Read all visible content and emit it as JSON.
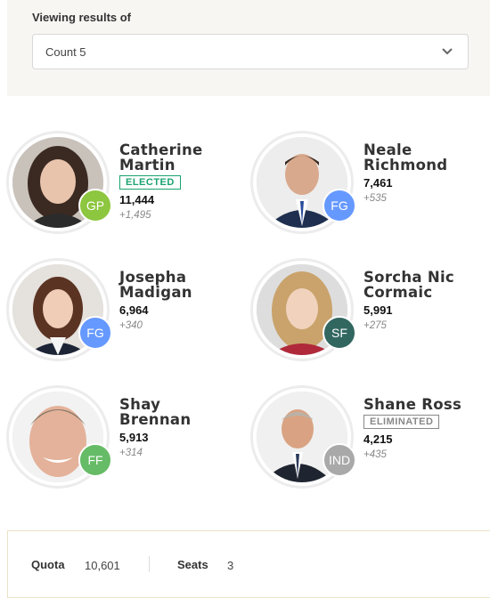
{
  "filter": {
    "label": "Viewing results of",
    "selected": "Count 5"
  },
  "candidates": [
    {
      "first": "Catherine",
      "last": "Martin",
      "party": "GP",
      "party_color": "#8dc63f",
      "status": "ELECTED",
      "status_color": "#1aa36f",
      "votes": "11,444",
      "change": "+1,495"
    },
    {
      "first": "Neale",
      "last": "Richmond",
      "party": "FG",
      "party_color": "#6699ff",
      "status": "",
      "status_color": "",
      "votes": "7,461",
      "change": "+535"
    },
    {
      "first": "Josepha",
      "last": "Madigan",
      "party": "FG",
      "party_color": "#6699ff",
      "status": "",
      "status_color": "",
      "votes": "6,964",
      "change": "+340"
    },
    {
      "first": "Sorcha Nic",
      "last": "Cormaic",
      "party": "SF",
      "party_color": "#326760",
      "status": "",
      "status_color": "",
      "votes": "5,991",
      "change": "+275"
    },
    {
      "first": "Shay",
      "last": "Brennan",
      "party": "FF",
      "party_color": "#66bb66",
      "status": "",
      "status_color": "",
      "votes": "5,913",
      "change": "+314"
    },
    {
      "first": "Shane Ross",
      "last": "",
      "party": "IND",
      "party_color": "#a9a9a9",
      "status": "ELIMINATED",
      "status_color": "#888888",
      "votes": "4,215",
      "change": "+435"
    }
  ],
  "summary": {
    "quota_label": "Quota",
    "quota": "10,601",
    "seats_label": "Seats",
    "seats": "3"
  }
}
